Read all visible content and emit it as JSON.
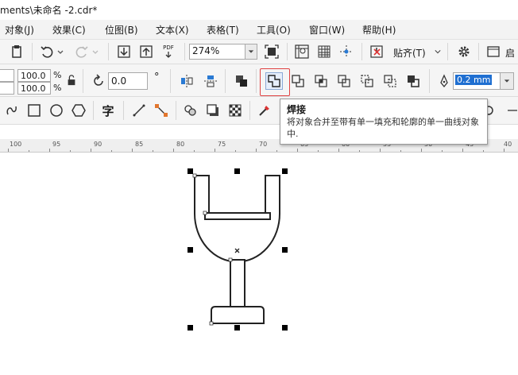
{
  "window": {
    "title": "ments\\未命名 -2.cdr*"
  },
  "menu": {
    "items": [
      "对象(J)",
      "效果(C)",
      "位图(B)",
      "文本(X)",
      "表格(T)",
      "工具(O)",
      "窗口(W)",
      "帮助(H)"
    ]
  },
  "toolbar_standard": {
    "pdf_label": "PDF",
    "zoom_value": "274%",
    "snap_label": "贴齐(T)",
    "launch_label": "启"
  },
  "property_bar": {
    "scale_x": "100.0",
    "scale_y": "100.0",
    "percent_x": "%",
    "percent_y": "%",
    "rotation": "0.0",
    "degree_symbol": "°",
    "outline_width": "0.2 mm"
  },
  "tooltip": {
    "title": "焊接",
    "body": "将对象合并至带有单一填充和轮廓的单一曲线对象中."
  },
  "ruler": {
    "labels": [
      "100",
      "95",
      "90",
      "85",
      "80",
      "75",
      "70",
      "65",
      "60",
      "55",
      "50",
      "45",
      "40"
    ]
  },
  "toolbox": {
    "text_tool_label": "字"
  }
}
